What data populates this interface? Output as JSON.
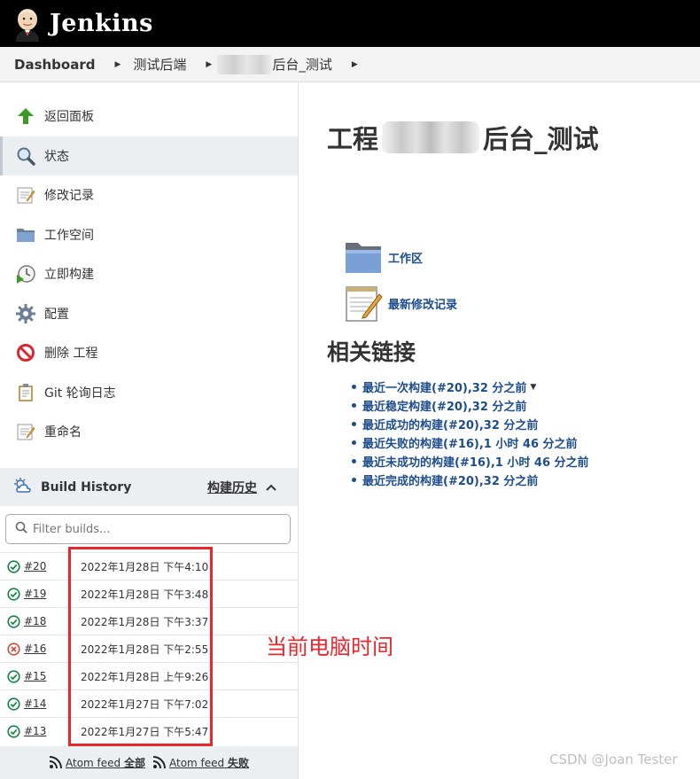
{
  "header": {
    "brand": "Jenkins",
    "logo_icon": "jenkins-butler-logo"
  },
  "breadcrumb": [
    {
      "label": "Dashboard"
    },
    {
      "label": "测试后端"
    },
    {
      "label": "后台_测试",
      "blurred_prefix": true
    }
  ],
  "sidebar": {
    "tasks": [
      {
        "label": "返回面板",
        "icon": "up-arrow-icon"
      },
      {
        "label": "状态",
        "icon": "magnifier-icon",
        "active": true
      },
      {
        "label": "修改记录",
        "icon": "notepad-icon"
      },
      {
        "label": "工作空间",
        "icon": "folder-icon"
      },
      {
        "label": "立即构建",
        "icon": "clock-play-icon"
      },
      {
        "label": "配置",
        "icon": "gear-icon"
      },
      {
        "label": "删除 工程",
        "icon": "no-entry-icon"
      },
      {
        "label": "Git 轮询日志",
        "icon": "clipboard-icon"
      },
      {
        "label": "重命名",
        "icon": "notepad-icon"
      }
    ],
    "build_history": {
      "title": "Build History",
      "trend_label": "构建历史",
      "filter_placeholder": "Filter builds...",
      "builds": [
        {
          "number": "#20",
          "status": "success",
          "date": "2022年1月28日 下午4:10"
        },
        {
          "number": "#19",
          "status": "success",
          "date": "2022年1月28日 下午3:48"
        },
        {
          "number": "#18",
          "status": "success",
          "date": "2022年1月28日 下午3:37"
        },
        {
          "number": "#16",
          "status": "failure",
          "date": "2022年1月28日 下午2:55"
        },
        {
          "number": "#15",
          "status": "success",
          "date": "2022年1月28日 上午9:26"
        },
        {
          "number": "#14",
          "status": "success",
          "date": "2022年1月27日 下午7:02"
        },
        {
          "number": "#13",
          "status": "success",
          "date": "2022年1月27日 下午5:47"
        }
      ],
      "feed_all_prefix": "Atom feed",
      "feed_all_suffix": "全部",
      "feed_fail_prefix": "Atom feed",
      "feed_fail_suffix": "失败"
    }
  },
  "annotation": {
    "note": "当前电脑时间",
    "color": "#e8262b"
  },
  "main": {
    "title_prefix": "工程",
    "title_suffix": "后台_测试",
    "workspace_link": "工作区",
    "changes_link": "最新修改记录",
    "permalinks_title": "相关链接",
    "permalinks": [
      {
        "label": "最近一次构建(#20),32 分之前",
        "dropdown": true
      },
      {
        "label": "最近稳定构建(#20),32 分之前"
      },
      {
        "label": "最近成功的构建(#20),32 分之前"
      },
      {
        "label": "最近失败的构建(#16),1 小时 46 分之前"
      },
      {
        "label": "最近未成功的构建(#16),1 小时 46 分之前"
      },
      {
        "label": "最近完成的构建(#20),32 分之前"
      }
    ]
  },
  "watermark": "CSDN @Joan Tester",
  "colors": {
    "header_bg": "#000000",
    "link": "#1d4d8a",
    "success": "#138347",
    "failure": "#d24939"
  }
}
